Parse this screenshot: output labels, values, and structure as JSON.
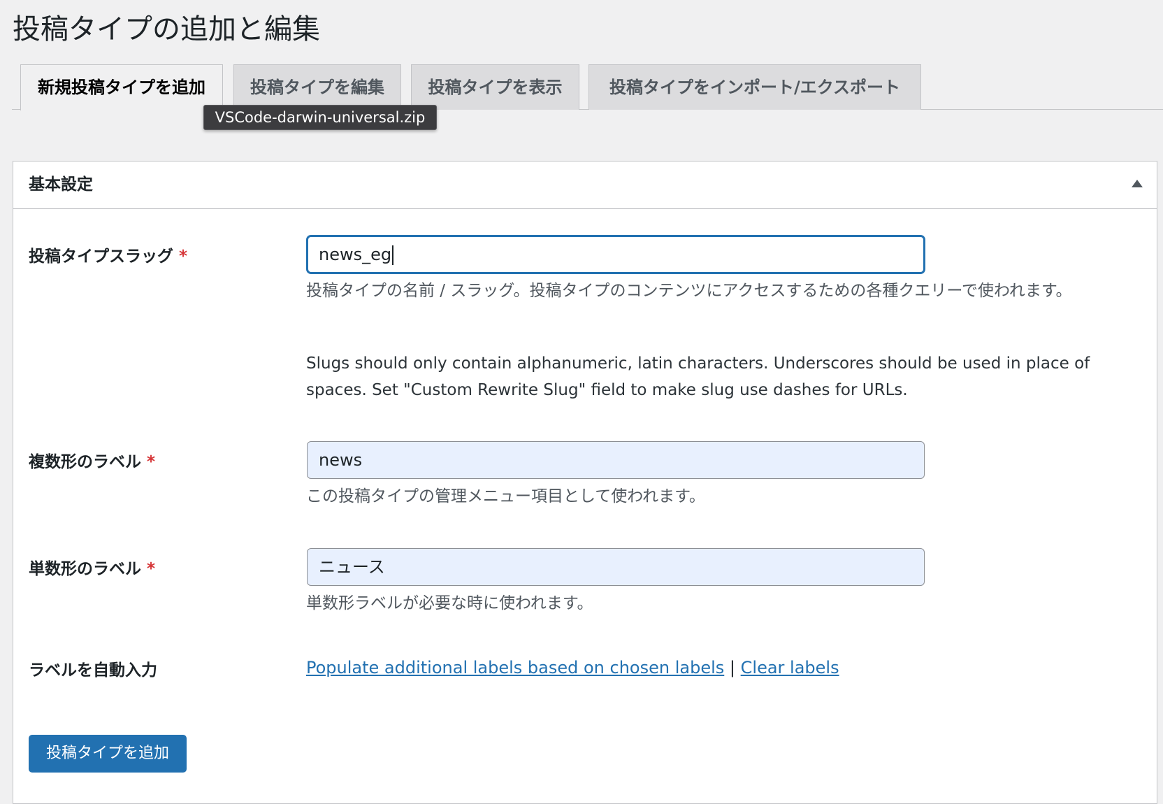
{
  "page": {
    "title": "投稿タイプの追加と編集"
  },
  "tabs": [
    {
      "label": "新規投稿タイプを追加",
      "active": true
    },
    {
      "label": "投稿タイプを編集",
      "active": false
    },
    {
      "label": "投稿タイプを表示",
      "active": false
    },
    {
      "label": "投稿タイプをインポート/エクスポート",
      "active": false
    }
  ],
  "tooltip": {
    "text": "VSCode-darwin-universal.zip"
  },
  "panel": {
    "title": "基本設定",
    "collapse_icon": "triangle-up-icon"
  },
  "fields": {
    "slug": {
      "label": "投稿タイプスラッグ",
      "required_mark": "*",
      "value": "news_eg",
      "description": "投稿タイプの名前 / スラッグ。投稿タイプのコンテンツにアクセスするための各種クエリーで使われます。",
      "note": "Slugs should only contain alphanumeric, latin characters. Underscores should be used in place of spaces. Set \"Custom Rewrite Slug\" field to make slug use dashes for URLs."
    },
    "plural": {
      "label": "複数形のラベル",
      "required_mark": "*",
      "value": "news",
      "description": "この投稿タイプの管理メニュー項目として使われます。"
    },
    "singular": {
      "label": "単数形のラベル",
      "required_mark": "*",
      "value": "ニュース",
      "description": "単数形ラベルが必要な時に使われます。"
    },
    "autofill": {
      "label": "ラベルを自動入力",
      "populate_link": "Populate additional labels based on chosen labels",
      "separator": "|",
      "clear_link": "Clear labels"
    }
  },
  "actions": {
    "submit_label": "投稿タイプを追加"
  },
  "colors": {
    "accent": "#2271b1",
    "required": "#d63638",
    "autofill_bg": "#e8f0fe"
  }
}
